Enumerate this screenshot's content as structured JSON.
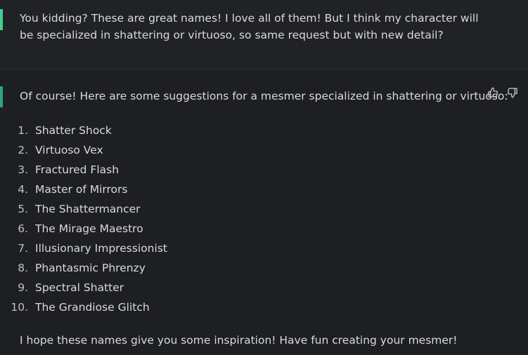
{
  "user_message": {
    "text": "You kidding? These are great names! I love all of them! But I think my character will be specialized in shattering or virtuoso, so same request but with new detail?"
  },
  "assistant_message": {
    "intro": "Of course! Here are some suggestions for a mesmer specialized in shattering or virtuoso:",
    "items": [
      {
        "num": "1.",
        "label": "Shatter Shock"
      },
      {
        "num": "2.",
        "label": "Virtuoso Vex"
      },
      {
        "num": "3.",
        "label": "Fractured Flash"
      },
      {
        "num": "4.",
        "label": "Master of Mirrors"
      },
      {
        "num": "5.",
        "label": "The Shattermancer"
      },
      {
        "num": "6.",
        "label": "The Mirage Maestro"
      },
      {
        "num": "7.",
        "label": "Illusionary Impressionist"
      },
      {
        "num": "8.",
        "label": "Phantasmic Phrenzy"
      },
      {
        "num": "9.",
        "label": "Spectral Shatter"
      },
      {
        "num": "10.",
        "label": "The Grandiose Glitch"
      }
    ],
    "closing": "I hope these names give you some inspiration! Have fun creating your mesmer!"
  },
  "icons": {
    "thumbs_up": "thumbs-up-icon",
    "thumbs_down": "thumbs-down-icon"
  },
  "colors": {
    "user_accent": "#3ecf8e",
    "assistant_accent": "#2aa77a",
    "background": "#212226"
  }
}
